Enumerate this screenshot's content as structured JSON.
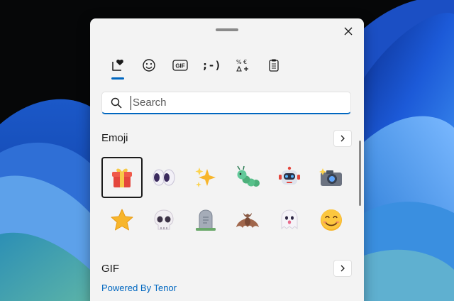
{
  "picker": {
    "tabs": [
      {
        "name": "favorites-icon",
        "label": ""
      },
      {
        "name": "emoji-icon",
        "label": ""
      },
      {
        "name": "gif-tab",
        "label": "GIF"
      },
      {
        "name": "kaomoji-tab",
        "label": ";-)"
      },
      {
        "name": "symbols-icon",
        "label": ""
      },
      {
        "name": "clipboard-icon",
        "label": ""
      }
    ],
    "active_tab": 0,
    "search": {
      "placeholder": "Search",
      "value": ""
    },
    "emoji_section": {
      "title": "Emoji"
    },
    "emojis": [
      {
        "name": "gift"
      },
      {
        "name": "eyes"
      },
      {
        "name": "sparkles"
      },
      {
        "name": "caterpillar"
      },
      {
        "name": "robot"
      },
      {
        "name": "camera"
      },
      {
        "name": "star"
      },
      {
        "name": "skull"
      },
      {
        "name": "headstone"
      },
      {
        "name": "bat"
      },
      {
        "name": "ghost"
      },
      {
        "name": "smiling-face"
      }
    ],
    "selected_emoji": 0,
    "gif_section": {
      "title": "GIF",
      "provider": "Powered By Tenor"
    }
  },
  "colors": {
    "accent": "#0067c0",
    "panel_bg": "#f3f3f3"
  }
}
